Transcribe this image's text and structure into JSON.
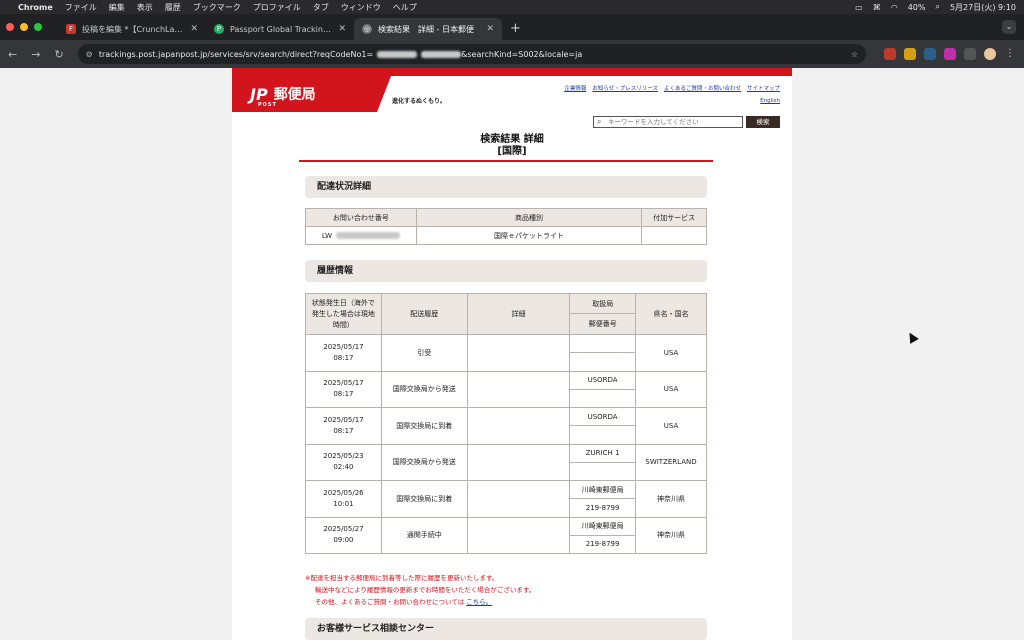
{
  "menubar": {
    "app": "Chrome",
    "items": [
      "ファイル",
      "編集",
      "表示",
      "履歴",
      "ブックマーク",
      "プロファイル",
      "タブ",
      "ウィンドウ",
      "ヘルプ"
    ],
    "battery": "40%",
    "datetime": "5月27日(火) 9:10"
  },
  "tabs": [
    {
      "title": "投稿を編集 *【CrunchLabs】ク",
      "favicon_color": "#c0392b"
    },
    {
      "title": "Passport Global Tracking Pag",
      "favicon_color": "#27ae60"
    },
    {
      "title": "検索結果　詳細 - 日本郵便",
      "favicon_color": "#777777"
    }
  ],
  "url": "trackings.post.japanpost.jp/services/srv/search/direct?reqCodeNo1=",
  "url_tail": "&searchKind=S002&locale=ja",
  "site": {
    "logo_mark": "JP",
    "logo_sub": "POST",
    "logo_name": "郵便局",
    "tagline": "進化するぬくもり。",
    "top_links": [
      "企業情報",
      "お知らせ・プレスリリース",
      "よくあるご質問・お問い合わせ",
      "サイトマップ"
    ],
    "english": "English",
    "search_placeholder": "キーワードを入力してください",
    "search_button": "検索"
  },
  "title_line1": "検索結果 詳細",
  "title_line2": "[国際]",
  "section1": {
    "heading": "配達状況詳細",
    "headers": [
      "お問い合わせ番号",
      "商品種別",
      "付加サービス"
    ],
    "tracking_prefix": "LW",
    "product": "国際ｅパケットライト",
    "service": ""
  },
  "section2": {
    "heading": "履歴情報",
    "headers": {
      "date": "状態発生日（海外で発生した場合は現地時間）",
      "status": "配送履歴",
      "detail": "詳細",
      "office": "取扱局",
      "postcode": "郵便番号",
      "region": "県名・国名"
    },
    "rows": [
      {
        "date": "2025/05/17",
        "time": "08:17",
        "status": "引受",
        "detail": "",
        "office": "",
        "postcode": "",
        "region": "USA"
      },
      {
        "date": "2025/05/17",
        "time": "08:17",
        "status": "国際交換局から発送",
        "detail": "",
        "office": "USORDA",
        "postcode": "",
        "region": "USA"
      },
      {
        "date": "2025/05/17",
        "time": "08:17",
        "status": "国際交換局に到着",
        "detail": "",
        "office": "USORDA",
        "postcode": "",
        "region": "USA"
      },
      {
        "date": "2025/05/23",
        "time": "02:40",
        "status": "国際交換局から発送",
        "detail": "",
        "office": "ZURICH 1",
        "postcode": "",
        "region": "SWITZERLAND"
      },
      {
        "date": "2025/05/26",
        "time": "10:01",
        "status": "国際交換局に到着",
        "detail": "",
        "office": "川崎東郵便局",
        "postcode": "219-8799",
        "region": "神奈川県"
      },
      {
        "date": "2025/05/27",
        "time": "09:00",
        "status": "通関手続中",
        "detail": "",
        "office": "川崎東郵便局",
        "postcode": "219-8799",
        "region": "神奈川県"
      }
    ]
  },
  "notes": {
    "line1": "※配達を担当する郵便局に到着等した際に履歴を更新いたします。",
    "line2": "輸送中などにより履歴情報の更新までお時間をいただく場合がございます。",
    "line3": "その他、よくあるご質問・お問い合わせについては",
    "link": "こちら。"
  },
  "section3": {
    "heading": "お客様サービス相談センター"
  }
}
